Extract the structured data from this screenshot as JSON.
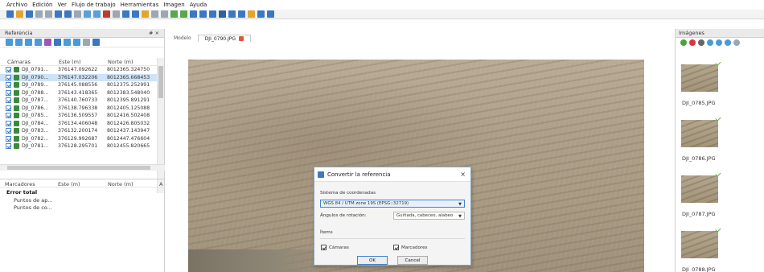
{
  "menu": [
    "Archivo",
    "Edición",
    "Ver",
    "Flujo de trabajo",
    "Herramientas",
    "Imagen",
    "Ayuda"
  ],
  "toolbar_colors": [
    "#3a78c2",
    "#e2a52e",
    "#3a78c2",
    "#9aa7b5",
    "#9aa7b5",
    "#3a78c2",
    "#3a78c2",
    "#9aa7b5",
    "#5aa0d8",
    "#5aa0d8",
    "#c0392b",
    "#9aa7b5",
    "#3a78c2",
    "#3a78c2",
    "#e2a52e",
    "#9aa7b5",
    "#9aa7b5",
    "#58a84a",
    "#58a84a",
    "#3a78c2",
    "#3a78c2",
    "#3a78c2",
    "#2f5f9e",
    "#3a78c2",
    "#3a78c2",
    "#e2a52e",
    "#3a78c2",
    "#3a78c2"
  ],
  "reference_panel": {
    "title": "Referencia",
    "controls": "# ×",
    "tool_colors": [
      "#4a9ad8",
      "#4a9ad8",
      "#4a9ad8",
      "#4a9ad8",
      "#9b59b6",
      "#3a78c2",
      "#4a9ad8",
      "#4a9ad8",
      "#9aa7b5",
      "#3a78c2"
    ],
    "cameras_header": {
      "name": "Cámaras",
      "east": "Este (m)",
      "north": "Norte (m)"
    },
    "cameras": [
      {
        "name": "DJI_0791...",
        "east": "376147.092622",
        "north": "8012365.324750",
        "selected": false
      },
      {
        "name": "DJI_0790...",
        "east": "376147.032206",
        "north": "8012365.668453",
        "selected": true
      },
      {
        "name": "DJI_0789...",
        "east": "376145.088556",
        "north": "8012375.252991",
        "selected": false
      },
      {
        "name": "DJI_0788...",
        "east": "376143.418365",
        "north": "8012383.548040",
        "selected": false
      },
      {
        "name": "DJI_0787...",
        "east": "376140.760733",
        "north": "8012395.891291",
        "selected": false
      },
      {
        "name": "DJI_0786...",
        "east": "376138.796338",
        "north": "8012405.125088",
        "selected": false
      },
      {
        "name": "DJI_0785...",
        "east": "376136.509557",
        "north": "8012416.502408",
        "selected": false
      },
      {
        "name": "DJI_0784...",
        "east": "376134.406048",
        "north": "8012426.805032",
        "selected": false
      },
      {
        "name": "DJI_0783...",
        "east": "376132.200174",
        "north": "8012437.143947",
        "selected": false
      },
      {
        "name": "DJI_0782...",
        "east": "376129.992687",
        "north": "8012447.476604",
        "selected": false
      },
      {
        "name": "DJI_0781...",
        "east": "376128.295701",
        "north": "8012455.820665",
        "selected": false
      }
    ],
    "markers_header": {
      "name": "Marcadores",
      "east": "Este (m)",
      "north": "Norte (m)",
      "extra": "A"
    },
    "markers": [
      {
        "label": "Error total",
        "style": "bold"
      },
      {
        "label": "Puntos de ap...",
        "style": "sub"
      },
      {
        "label": "Puntos de co...",
        "style": "sub"
      }
    ]
  },
  "tabs": {
    "model": "Modelo",
    "image": "DJI_0790.JPG"
  },
  "dialog": {
    "title": "Convertir la referencia",
    "close": "×",
    "crs_label": "Sistema de coordenadas",
    "crs_value": "WGS 84 / UTM zone 19S (EPSG::32719)",
    "angles_label": "Ángulos de rotación:",
    "angles_value": "Guiñada, cabeceo, alabeo",
    "items_label": "Ítems",
    "cameras_check": "Cámaras",
    "markers_check": "Marcadores",
    "ok": "OK",
    "cancel": "Cancel"
  },
  "images_panel": {
    "title": "Imágenes",
    "tool_colors": [
      "#4aa63a",
      "#d9363e",
      "#666666",
      "#4a9ad8",
      "#4a9ad8",
      "#4a9ad8",
      "#9aa7b5"
    ],
    "thumbnails": [
      "DJI_0785.JPG",
      "DJI_0786.JPG",
      "DJI_0787.JPG",
      "DJI_0788.JPG"
    ]
  }
}
